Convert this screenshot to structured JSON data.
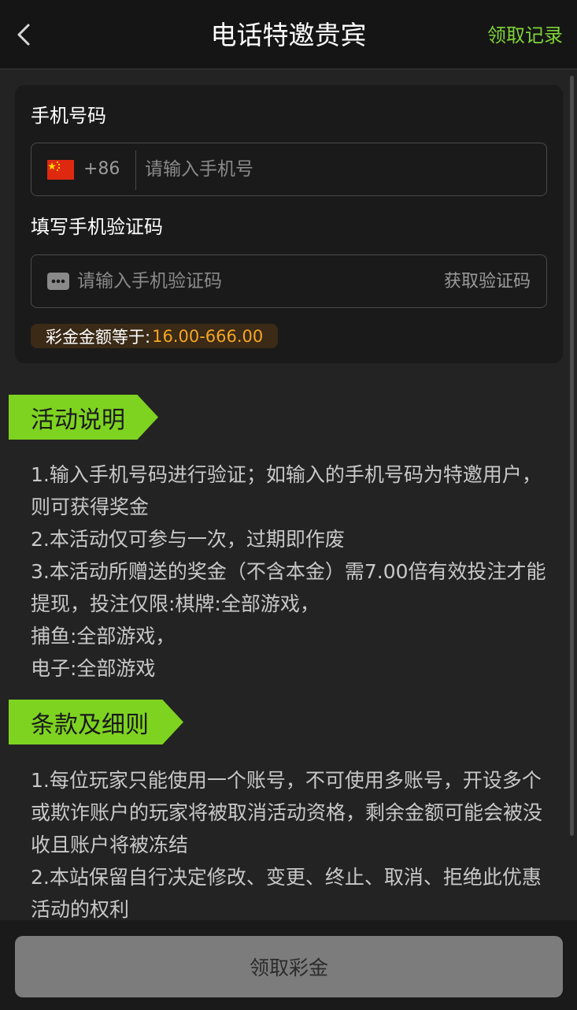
{
  "header": {
    "title": "电话特邀贵宾",
    "records_link": "领取记录",
    "back_icon": "chevron-left-icon"
  },
  "form": {
    "phone_label": "手机号码",
    "country_code": "+86",
    "phone_placeholder": "请输入手机号",
    "code_label": "填写手机验证码",
    "code_placeholder": "请输入手机验证码",
    "get_code_button": "获取验证码",
    "bonus_label": "彩金金额等于:",
    "bonus_value": "16.00-666.00",
    "flag_icon": "china-flag-icon",
    "sms_icon": "sms-icon"
  },
  "activity": {
    "title": "活动说明",
    "lines": [
      "1.输入手机号码进行验证；如输入的手机号码为特邀用户，则可获得奖金",
      "2.本活动仅可参与一次，过期即作废",
      "3.本活动所赠送的奖金（不含本金）需7.00倍有效投注才能提现，投注仅限:棋牌:全部游戏，",
      "捕鱼:全部游戏，",
      "电子:全部游戏"
    ]
  },
  "terms": {
    "title": "条款及细则",
    "lines": [
      "1.每位玩家只能使用一个账号，不可使用多账号，开设多个或欺诈账户的玩家将被取消活动资格，剩余金额可能会被没收且账户将被冻结",
      "2.本站保留自行决定修改、变更、终止、取消、拒绝此优惠活动的权利"
    ]
  },
  "footer": {
    "claim_button": "领取彩金"
  },
  "colors": {
    "accent_green": "#7ed321",
    "bonus_orange": "#f5a623",
    "background": "#232323"
  }
}
